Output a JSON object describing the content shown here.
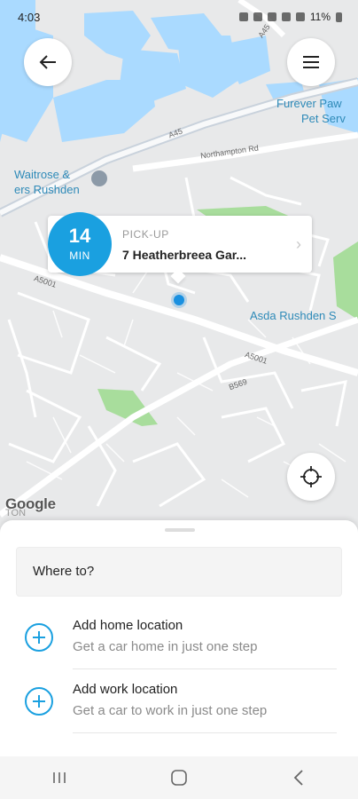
{
  "status_bar": {
    "time": "4:03",
    "battery": "11%"
  },
  "map": {
    "labels": {
      "waitrose_line1": "Waitrose &",
      "waitrose_line2": "ers Rushden",
      "furever_line1": "Furever Paw",
      "furever_line2": "Pet Serv",
      "asda": "Asda Rushden S",
      "northampton_rd": "Northampton Rd",
      "a45": "A45",
      "a45_top": "A45",
      "a5001_left": "A5001",
      "a5001_right": "A5001",
      "b569": "B569",
      "bottom_left": "TON"
    },
    "attribution": "Google"
  },
  "pickup": {
    "eta_number": "14",
    "eta_unit": "MIN",
    "label": "PICK-UP",
    "address": "7 Heatherbreea Gar..."
  },
  "sheet": {
    "where_to": "Where to?",
    "home": {
      "title": "Add home location",
      "subtitle": "Get a car home in just one step"
    },
    "work": {
      "title": "Add work location",
      "subtitle": "Get a car to work in just one step"
    }
  },
  "colors": {
    "accent": "#1aa0e0",
    "water": "#aadaff",
    "park": "#a8dd9c"
  },
  "icons": {
    "back": "back-arrow-icon",
    "menu": "hamburger-menu-icon",
    "locate": "crosshair-icon",
    "plus": "plus-circle-icon"
  }
}
